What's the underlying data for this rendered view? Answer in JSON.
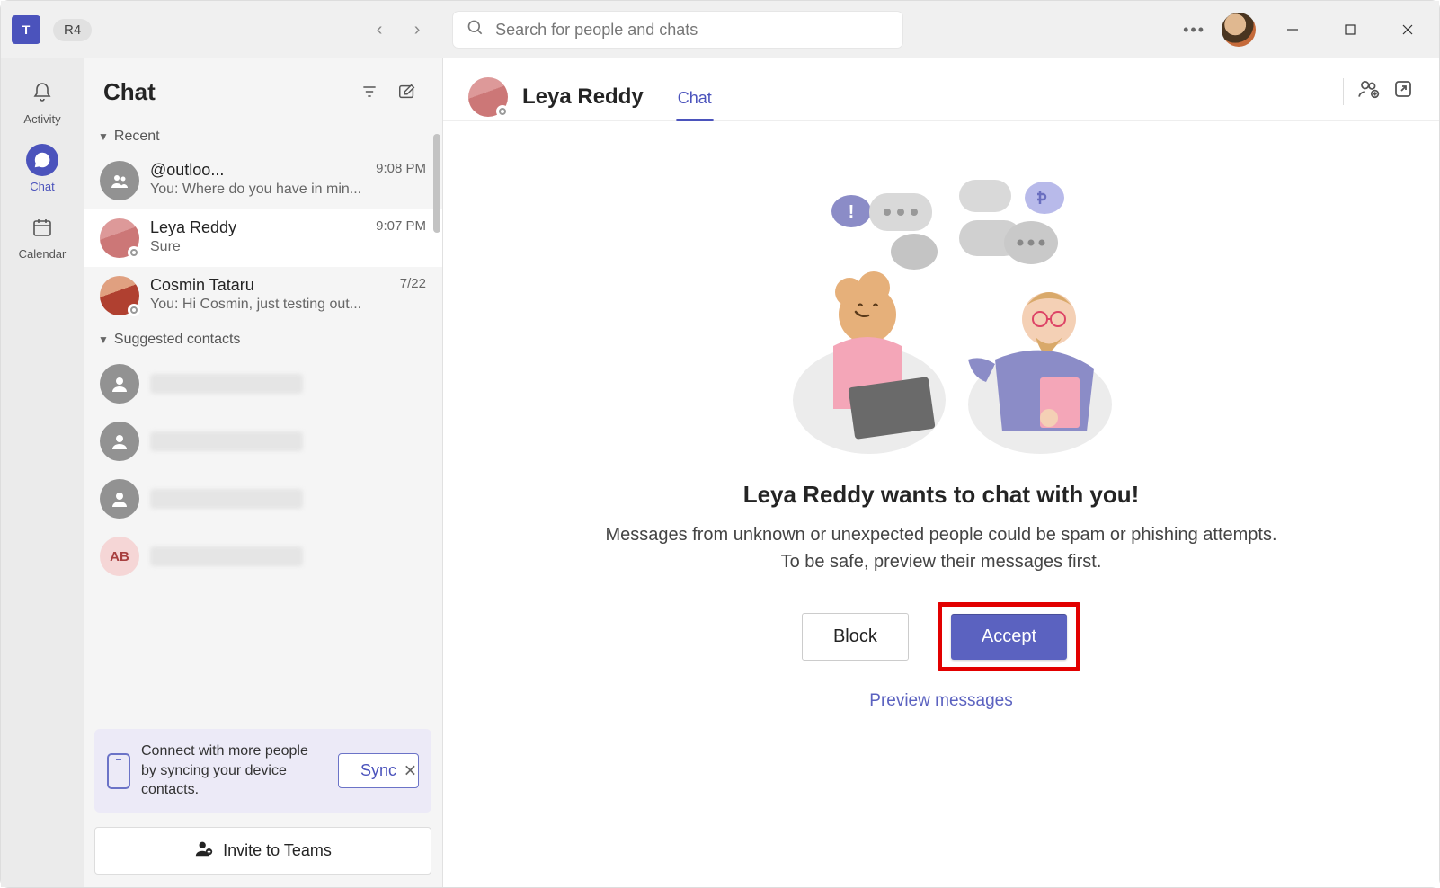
{
  "titlebar": {
    "org_badge": "R4",
    "search_placeholder": "Search for people and chats"
  },
  "rail": {
    "items": [
      {
        "label": "Activity"
      },
      {
        "label": "Chat"
      },
      {
        "label": "Calendar"
      }
    ]
  },
  "chatlist": {
    "title": "Chat",
    "recent_label": "Recent",
    "recent": [
      {
        "name": "@outloo...",
        "time": "9:08 PM",
        "preview": "You: Where do you have in min..."
      },
      {
        "name": "Leya Reddy",
        "time": "9:07 PM",
        "preview": "Sure"
      },
      {
        "name": "Cosmin Tataru",
        "time": "7/22",
        "preview": "You: Hi Cosmin, just testing out..."
      }
    ],
    "suggested_label": "Suggested contacts",
    "suggested_initials": [
      "",
      "",
      "",
      "AB"
    ],
    "sync": {
      "text": "Connect with more people by syncing your device contacts.",
      "button": "Sync"
    },
    "invite_button": "Invite to Teams"
  },
  "main": {
    "contact_name": "Leya Reddy",
    "tab_chat": "Chat",
    "invite_title": "Leya Reddy wants to chat with you!",
    "invite_desc": "Messages from unknown or unexpected people could be spam or phishing attempts. To be safe, preview their messages first.",
    "block_button": "Block",
    "accept_button": "Accept",
    "preview_link": "Preview messages"
  }
}
